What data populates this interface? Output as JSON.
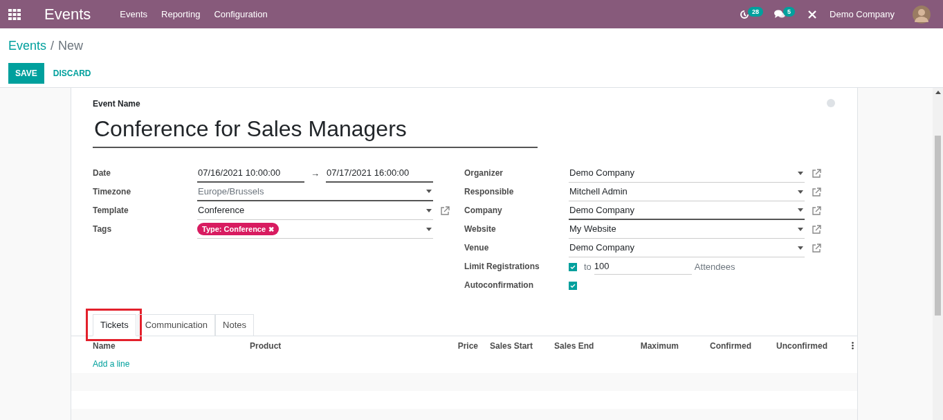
{
  "navbar": {
    "app": "Events",
    "menu": [
      "Events",
      "Reporting",
      "Configuration"
    ],
    "activity_count": "28",
    "message_count": "5",
    "company": "Demo Company"
  },
  "breadcrumb": {
    "parent": "Events",
    "separator": "/",
    "current": "New"
  },
  "buttons": {
    "save": "SAVE",
    "discard": "DISCARD"
  },
  "form": {
    "name_label": "Event Name",
    "name": "Conference for Sales Managers",
    "left": [
      {
        "kind": "daterange",
        "label": "Date",
        "start": "07/16/2021 10:00:00",
        "arrow": "→",
        "end": "07/17/2021 16:00:00"
      },
      {
        "kind": "select",
        "label": "Timezone",
        "placeholder": "Europe/Brussels",
        "link": false,
        "required": true
      },
      {
        "kind": "select",
        "label": "Template",
        "value": "Conference",
        "link": true,
        "required": false
      },
      {
        "kind": "tags",
        "label": "Tags",
        "tags": [
          {
            "text": "Type: Conference",
            "remove": "✖",
            "color": "#d81b60"
          }
        ]
      }
    ],
    "right": [
      {
        "kind": "select",
        "label": "Organizer",
        "value": "Demo Company",
        "link": true,
        "required": false
      },
      {
        "kind": "select",
        "label": "Responsible",
        "value": "Mitchell Admin",
        "link": true,
        "required": false
      },
      {
        "kind": "select",
        "label": "Company",
        "value": "Demo Company",
        "link": true,
        "required": true
      },
      {
        "kind": "select",
        "label": "Website",
        "value": "My Website",
        "link": true,
        "required": false
      },
      {
        "kind": "select",
        "label": "Venue",
        "value": "Demo Company",
        "link": true,
        "required": false
      },
      {
        "kind": "limit",
        "label": "Limit Registrations",
        "checked": true,
        "to": "to",
        "value": "100",
        "unit": "Attendees"
      },
      {
        "kind": "checkbox",
        "label": "Autoconfirmation",
        "checked": true
      }
    ]
  },
  "tabs": [
    {
      "label": "Tickets",
      "selected": true,
      "highlighted": true
    },
    {
      "label": "Communication",
      "selected": false,
      "highlighted": false
    },
    {
      "label": "Notes",
      "selected": false,
      "highlighted": false
    }
  ],
  "table": {
    "columns": [
      "Name",
      "Product",
      "Price",
      "Sales Start",
      "Sales End",
      "Maximum",
      "Confirmed",
      "Unconfirmed"
    ],
    "add_line": "Add a line"
  }
}
